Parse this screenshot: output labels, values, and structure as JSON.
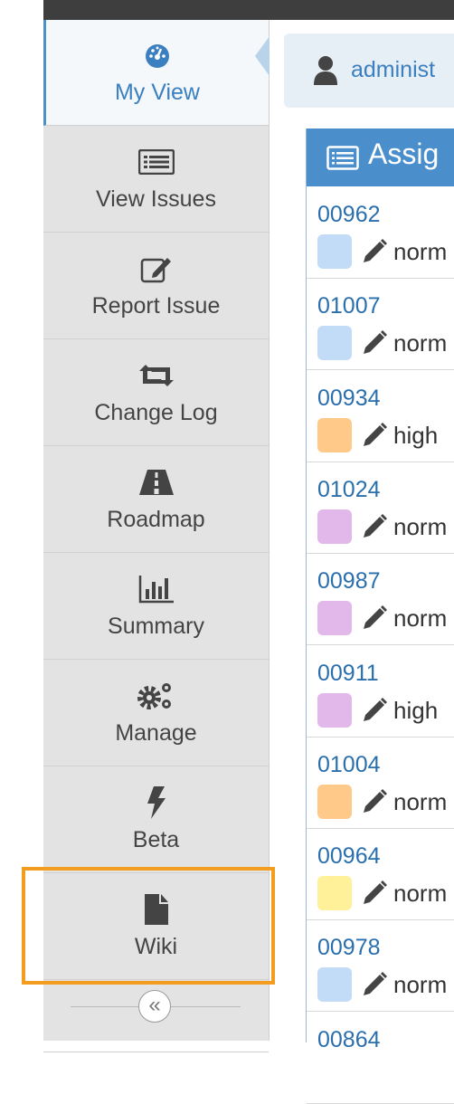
{
  "header": {
    "user_name": "administ"
  },
  "nav": [
    {
      "label": "My View",
      "icon": "dashboard-icon",
      "active": true
    },
    {
      "label": "View Issues",
      "icon": "list-icon"
    },
    {
      "label": "Report Issue",
      "icon": "edit-icon"
    },
    {
      "label": "Change Log",
      "icon": "retweet-icon"
    },
    {
      "label": "Roadmap",
      "icon": "road-icon"
    },
    {
      "label": "Summary",
      "icon": "bar-chart-icon"
    },
    {
      "label": "Manage",
      "icon": "gears-icon"
    },
    {
      "label": "Beta",
      "icon": "bolt-icon"
    },
    {
      "label": "Wiki",
      "icon": "file-icon"
    }
  ],
  "collapse_glyph": "«",
  "panel": {
    "title": "Assig",
    "rows": [
      {
        "id": "00962",
        "priority": "norm",
        "color": "#c2dcf7"
      },
      {
        "id": "01007",
        "priority": "norm",
        "color": "#c2dcf7"
      },
      {
        "id": "00934",
        "priority": "high",
        "color": "#ffc98a"
      },
      {
        "id": "01024",
        "priority": "norm",
        "color": "#e2b8ea"
      },
      {
        "id": "00987",
        "priority": "norm",
        "color": "#e2b8ea"
      },
      {
        "id": "00911",
        "priority": "high",
        "color": "#e2b8ea"
      },
      {
        "id": "01004",
        "priority": "norm",
        "color": "#ffc98a"
      },
      {
        "id": "00964",
        "priority": "norm",
        "color": "#fff09a"
      },
      {
        "id": "00978",
        "priority": "norm",
        "color": "#c2dcf7"
      },
      {
        "id": "00864",
        "priority": "",
        "color": ""
      }
    ]
  }
}
